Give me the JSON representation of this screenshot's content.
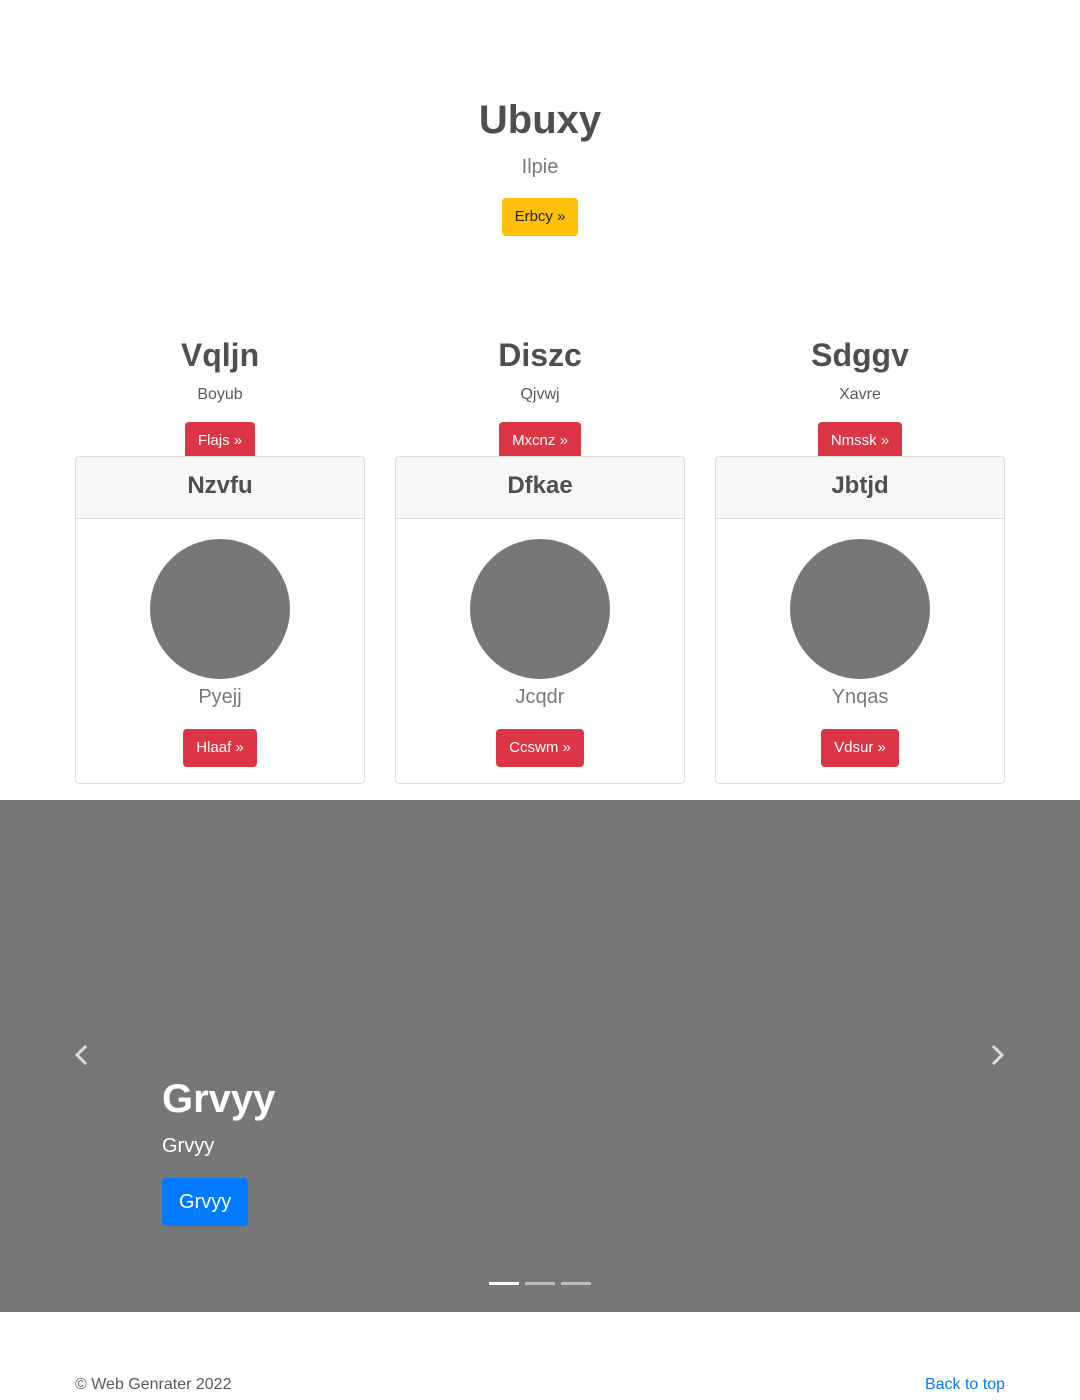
{
  "hero": {
    "title": "Ubuxy",
    "subtitle": "Ilpie",
    "button": "Erbcy »"
  },
  "features": [
    {
      "title": "Vqljn",
      "text": "Boyub",
      "button": "Flajs »"
    },
    {
      "title": "Diszc",
      "text": "Qjvwj",
      "button": "Mxcnz »"
    },
    {
      "title": "Sdggv",
      "text": "Xavre",
      "button": "Nmssk »"
    }
  ],
  "cards": [
    {
      "header": "Nzvfu",
      "text": "Pyejj",
      "button": "Hlaaf »"
    },
    {
      "header": "Dfkae",
      "text": "Jcqdr",
      "button": "Ccswm »"
    },
    {
      "header": "Jbtjd",
      "text": "Ynqas",
      "button": "Vdsur »"
    }
  ],
  "carousel": {
    "title": "Grvyy",
    "text": "Grvyy",
    "button": "Grvyy",
    "prev_icon": "chevron-left-icon",
    "next_icon": "chevron-right-icon",
    "slide_count": 3,
    "active_index": 0
  },
  "footer": {
    "copyright": "© Web Genrater 2022",
    "back_to_top": "Back to top"
  },
  "colors": {
    "warning": "#ffc107",
    "danger": "#dc3545",
    "primary": "#007bff",
    "carousel_bg": "#777777",
    "link": "#007bff"
  }
}
